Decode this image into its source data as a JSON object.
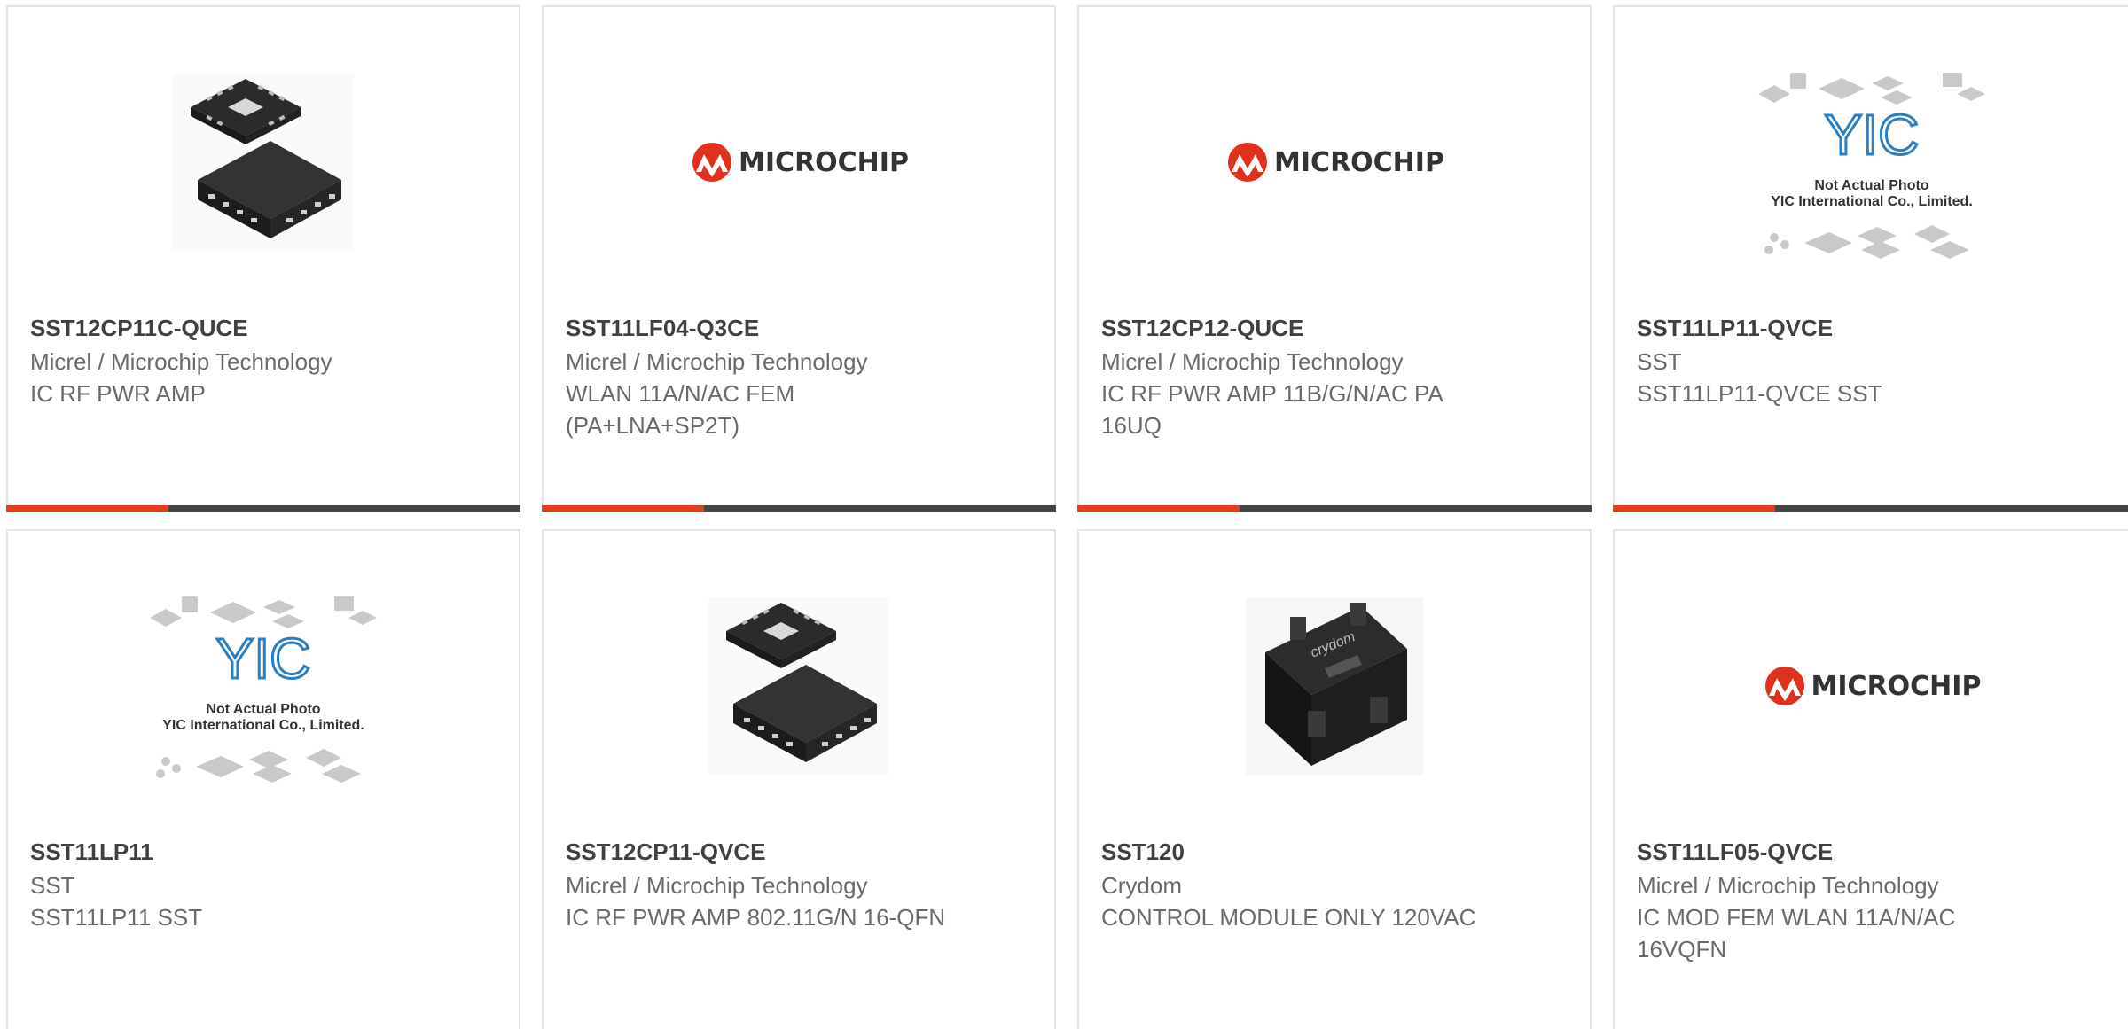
{
  "colors": {
    "accent_red": "#e0401e",
    "accent_dark": "#444444",
    "brand_red": "#e0301e"
  },
  "products": [
    {
      "part": "SST12CP11C-QUCE",
      "maker": "Micrel / Microchip Technology",
      "desc": "IC RF PWR AMP",
      "image": "qfn-chip-photo"
    },
    {
      "part": "SST11LF04-Q3CE",
      "maker": "Micrel / Microchip Technology",
      "desc": "WLAN 11A/N/AC FEM (PA+LNA+SP2T)",
      "image": "microchip-logo"
    },
    {
      "part": "SST12CP12-QUCE",
      "maker": "Micrel / Microchip Technology",
      "desc": "IC RF PWR AMP 11B/G/N/AC PA 16UQ",
      "image": "microchip-logo"
    },
    {
      "part": "SST11LP11-QVCE",
      "maker": "SST",
      "desc": "SST11LP11-QVCE SST",
      "image": "yic-placeholder"
    },
    {
      "part": "SST11LP11",
      "maker": "SST",
      "desc": "SST11LP11 SST",
      "image": "yic-placeholder"
    },
    {
      "part": "SST12CP11-QVCE",
      "maker": "Micrel / Microchip Technology",
      "desc": "IC RF PWR AMP 802.11G/N 16-QFN",
      "image": "qfn-chip-photo"
    },
    {
      "part": "SST120",
      "maker": "Crydom",
      "desc": "CONTROL MODULE ONLY 120VAC",
      "image": "relay-photo"
    },
    {
      "part": "SST11LF05-QVCE",
      "maker": "Micrel / Microchip Technology",
      "desc": "IC MOD FEM WLAN 11A/N/AC 16VQFN",
      "image": "microchip-logo"
    }
  ],
  "logos": {
    "microchip": "MICROCHIP",
    "yic_mark": "YIC",
    "yic_line1": "Not Actual Photo",
    "yic_line2": "YIC International Co., Limited.",
    "crydom": "crydom"
  }
}
